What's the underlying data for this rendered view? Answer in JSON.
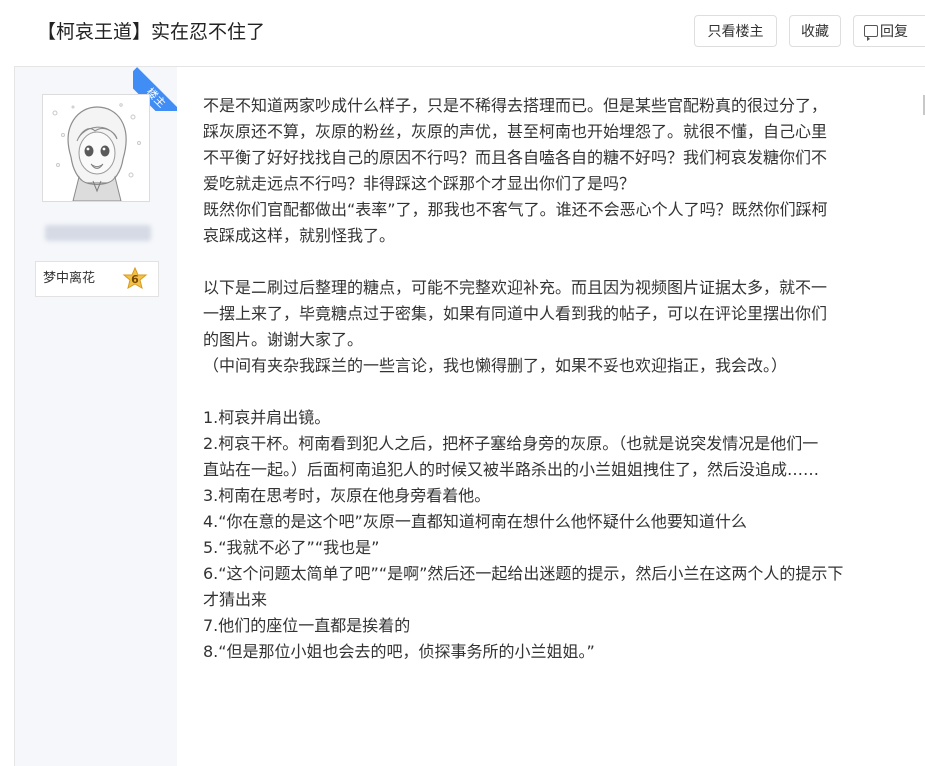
{
  "header": {
    "title": "【柯哀王道】实在忍不住了",
    "buttons": {
      "only_op": "只看楼主",
      "favorite": "收藏",
      "reply": "回复"
    }
  },
  "author": {
    "op_badge": "楼主",
    "level_name": "梦中离花",
    "level": "6"
  },
  "post": {
    "paragraphs": [
      [
        "不是不知道两家吵成什么样子，只是不稀得去搭理而已。但是某些官配粉真的很过分了，",
        "踩灰原还不算，灰原的粉丝，灰原的声优，甚至柯南也开始埋怨了。就很不懂，自己心里",
        "不平衡了好好找找自己的原因不行吗？而且各自嗑各自的糖不好吗？我们柯哀发糖你们不",
        "爱吃就走远点不行吗？非得踩这个踩那个才显出你们了是吗？",
        "既然你们官配都做出“表率”了，那我也不客气了。谁还不会恶心个人了吗？既然你们踩柯",
        "哀踩成这样，就别怪我了。"
      ],
      [
        "以下是二刷过后整理的糖点，可能不完整欢迎补充。而且因为视频图片证据太多，就不一",
        "一摆上来了，毕竟糖点过于密集，如果有同道中人看到我的帖子，可以在评论里摆出你们",
        "的图片。谢谢大家了。",
        "（中间有夹杂我踩兰的一些言论，我也懒得删了，如果不妥也欢迎指正，我会改。）"
      ],
      [
        "1.柯哀并肩出镜。",
        "2.柯哀干杯。柯南看到犯人之后，把杯子塞给身旁的灰原。（也就是说突发情况是他们一",
        "直站在一起。）后面柯南追犯人的时候又被半路杀出的小兰姐姐拽住了，然后没追成……",
        "3.柯南在思考时，灰原在他身旁看着他。",
        "4.“你在意的是这个吧”灰原一直都知道柯南在想什么他怀疑什么他要知道什么",
        "5.“我就不必了”“我也是”",
        "6.“这个问题太简单了吧”“是啊”然后还一起给出迷题的提示，然后小兰在这两个人的提示下",
        "才猜出来",
        "7.他们的座位一直都是挨着的",
        "8.“但是那位小姐也会去的吧，侦探事务所的小兰姐姐。”"
      ]
    ]
  },
  "colors": {
    "op_badge_bg": "#3f8df5",
    "author_column_bg": "#f5f7fa",
    "level_badge": "#f3c24a"
  }
}
